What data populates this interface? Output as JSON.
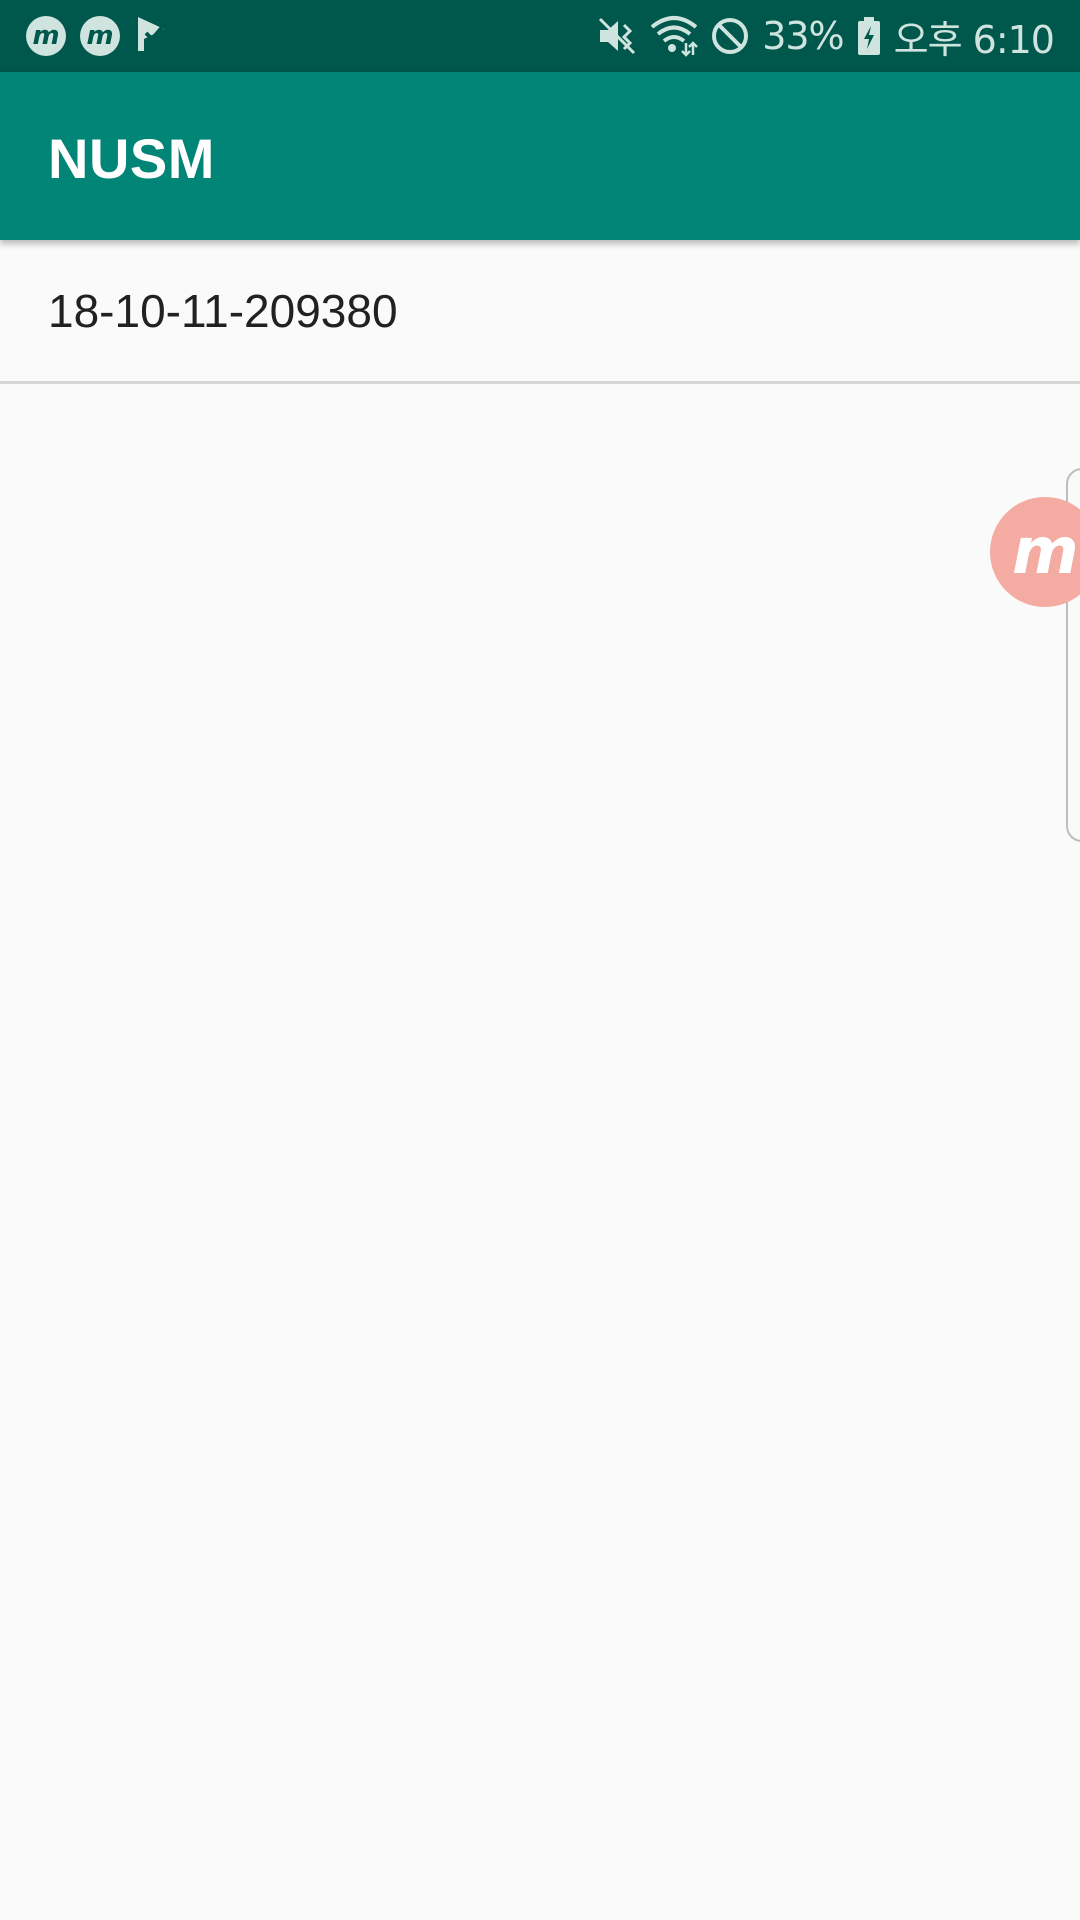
{
  "status_bar": {
    "notification_icons": [
      "m-app-icon",
      "m-app-icon",
      "check-flag-icon"
    ],
    "m_icon_glyph": "m",
    "battery_percent": "33%",
    "time": "오후 6:10",
    "system_icons": [
      "vibrate-mute-icon",
      "wifi-icon",
      "do-not-disturb-icon",
      "battery-charging-icon"
    ]
  },
  "app_bar": {
    "title": "NUSM"
  },
  "list": {
    "items": [
      {
        "label": "18-10-11-209380"
      }
    ]
  },
  "floating_bubble": {
    "glyph": "m",
    "icon": "m-app-bubble-icon"
  },
  "colors": {
    "status_bar": "#00574b",
    "app_bar": "#008577",
    "background": "#fafafa",
    "bubble": "#f3aba2"
  }
}
